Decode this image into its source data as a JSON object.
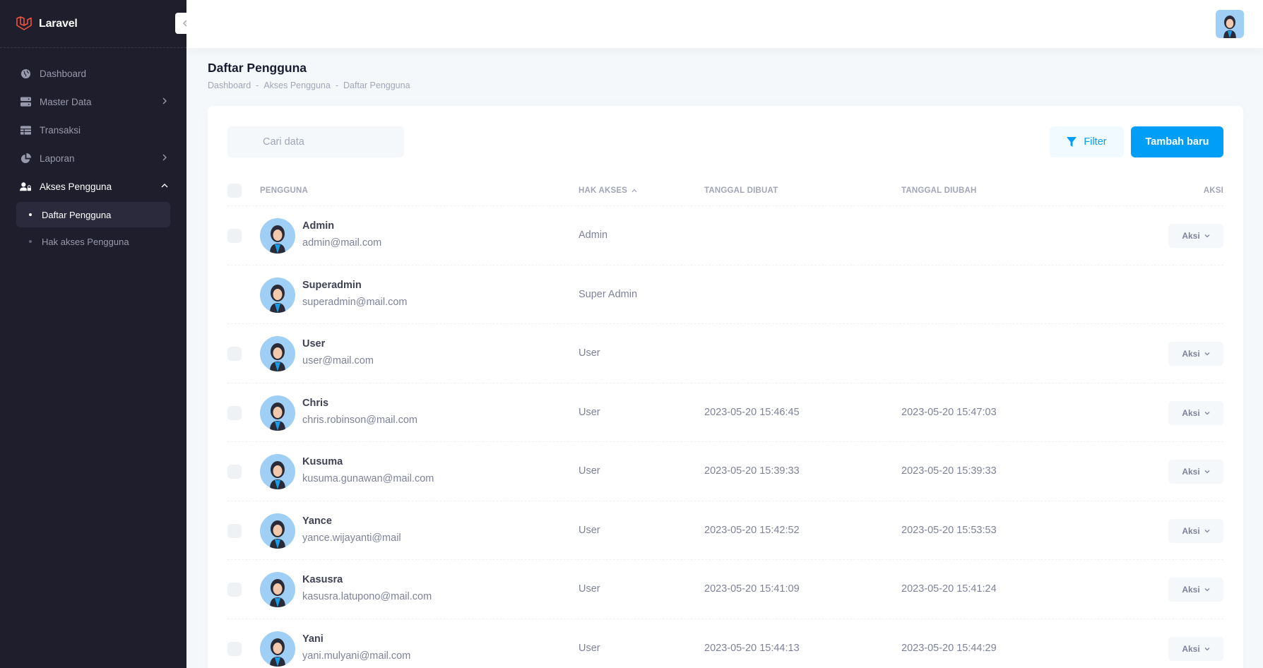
{
  "brand": {
    "name": "Laravel"
  },
  "sidebar": {
    "items": [
      {
        "label": "Dashboard",
        "icon": "globe-icon"
      },
      {
        "label": "Master Data",
        "icon": "server-icon"
      },
      {
        "label": "Transaksi",
        "icon": "table-icon"
      },
      {
        "label": "Laporan",
        "icon": "pie-chart-icon"
      },
      {
        "label": "Akses Pengguna",
        "icon": "user-lock-icon"
      }
    ],
    "sub_items": [
      {
        "label": "Daftar Pengguna"
      },
      {
        "label": "Hak akses Pengguna"
      }
    ]
  },
  "page": {
    "title": "Daftar Pengguna",
    "breadcrumb": [
      "Dashboard",
      "Akses Pengguna",
      "Daftar Pengguna"
    ],
    "breadcrumb_sep": "-"
  },
  "toolbar": {
    "search_placeholder": "Cari data",
    "filter_label": "Filter",
    "add_label": "Tambah baru"
  },
  "table": {
    "columns": [
      "Pengguna",
      "Hak Akses",
      "Tanggal Dibuat",
      "Tanggal Diubah",
      "Aksi"
    ],
    "action_label": "Aksi",
    "rows": [
      {
        "name": "Admin",
        "email": "admin@mail.com",
        "role": "Admin",
        "created": "",
        "updated": "",
        "checkbox": true,
        "action": true
      },
      {
        "name": "Superadmin",
        "email": "superadmin@mail.com",
        "role": "Super Admin",
        "created": "",
        "updated": "",
        "checkbox": false,
        "action": false
      },
      {
        "name": "User",
        "email": "user@mail.com",
        "role": "User",
        "created": "",
        "updated": "",
        "checkbox": true,
        "action": true
      },
      {
        "name": "Chris",
        "email": "chris.robinson@mail.com",
        "role": "User",
        "created": "2023-05-20 15:46:45",
        "updated": "2023-05-20 15:47:03",
        "checkbox": true,
        "action": true
      },
      {
        "name": "Kusuma",
        "email": "kusuma.gunawan@mail.com",
        "role": "User",
        "created": "2023-05-20 15:39:33",
        "updated": "2023-05-20 15:39:33",
        "checkbox": true,
        "action": true
      },
      {
        "name": "Yance",
        "email": "yance.wijayanti@mail",
        "role": "User",
        "created": "2023-05-20 15:42:52",
        "updated": "2023-05-20 15:53:53",
        "checkbox": true,
        "action": true
      },
      {
        "name": "Kasusra",
        "email": "kasusra.latupono@mail.com",
        "role": "User",
        "created": "2023-05-20 15:41:09",
        "updated": "2023-05-20 15:41:24",
        "checkbox": true,
        "action": true
      },
      {
        "name": "Yani",
        "email": "yani.mulyani@mail.com",
        "role": "User",
        "created": "2023-05-20 15:44:13",
        "updated": "2023-05-20 15:44:29",
        "checkbox": true,
        "action": true
      }
    ]
  },
  "colors": {
    "sidebar_bg": "#1e1e2d",
    "primary": "#009ef7",
    "page_bg": "#f5f8fa"
  }
}
